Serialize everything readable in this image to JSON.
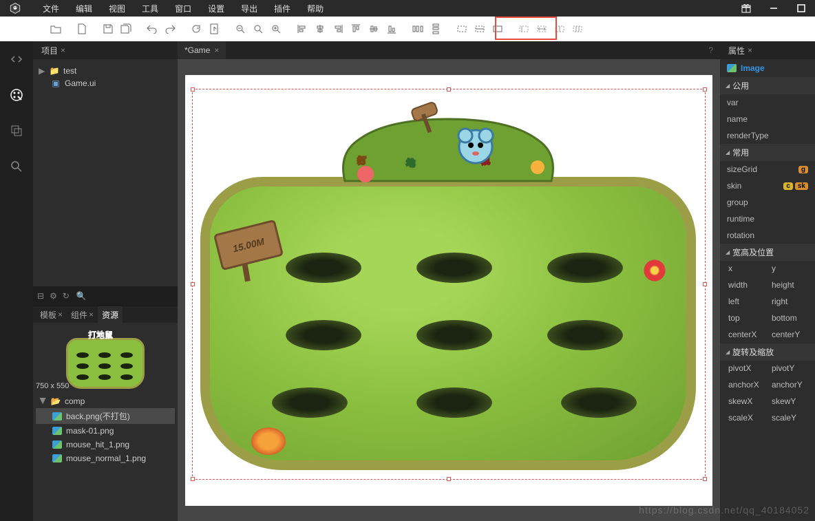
{
  "menubar": {
    "items": [
      "文件",
      "编辑",
      "视图",
      "工具",
      "窗口",
      "设置",
      "导出",
      "插件",
      "帮助"
    ]
  },
  "project": {
    "tab_label": "项目",
    "root": "test",
    "files": [
      "Game.ui"
    ]
  },
  "resource": {
    "tabs": [
      "模板",
      "组件",
      "资源"
    ],
    "active_tab": 2,
    "dimensions": "750 x 550",
    "folder": "comp",
    "files": [
      "back.png(不打包)",
      "mask-01.png",
      "mouse_hit_1.png",
      "mouse_normal_1.png"
    ],
    "selected": 0
  },
  "canvas": {
    "tab_label": "*Game"
  },
  "scene": {
    "sign_text": "15.00M"
  },
  "properties": {
    "tab_label": "属性",
    "type_label": "Image",
    "sections": {
      "common": "公用",
      "frequent": "常用",
      "size_pos": "宽高及位置",
      "rotate_scale": "旋转及缩放"
    },
    "common_props": [
      "var",
      "name",
      "renderType"
    ],
    "frequent_props": [
      "sizeGrid",
      "skin",
      "group",
      "runtime",
      "rotation"
    ],
    "badges": {
      "sizeGrid": "g",
      "skin_c": "c",
      "skin": "sk"
    },
    "sizepos_pairs": [
      [
        "x",
        "y"
      ],
      [
        "width",
        "height"
      ],
      [
        "left",
        "right"
      ],
      [
        "top",
        "bottom"
      ],
      [
        "centerX",
        "centerY"
      ]
    ],
    "rotscale_pairs": [
      [
        "pivotX",
        "pivotY"
      ],
      [
        "anchorX",
        "anchorY"
      ],
      [
        "skewX",
        "skewY"
      ],
      [
        "scaleX",
        "scaleY"
      ]
    ]
  },
  "watermark": "https://blog.csdn.net/qq_40184052"
}
